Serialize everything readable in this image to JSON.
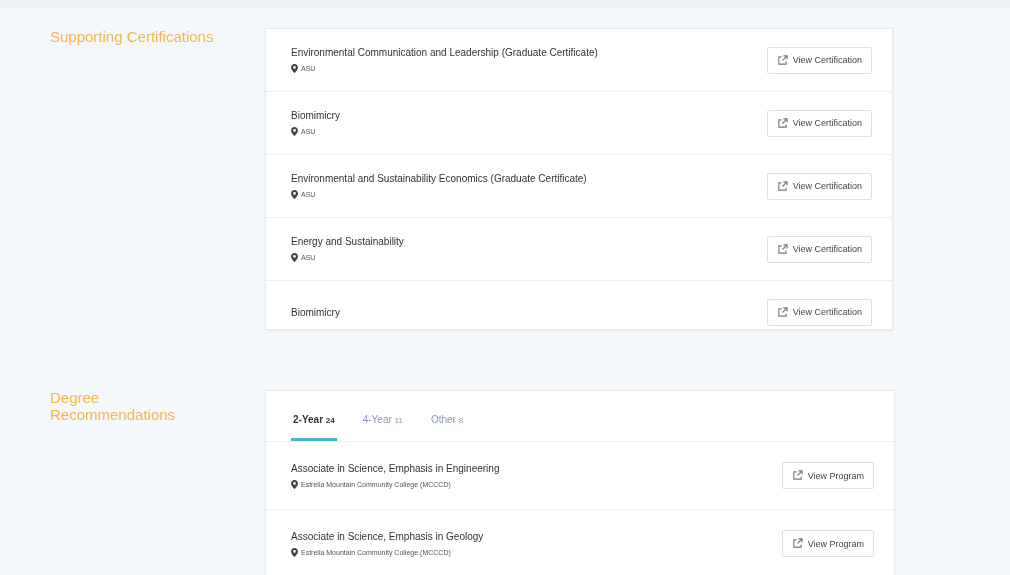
{
  "certifications": {
    "heading": "Supporting Certifications",
    "items": [
      {
        "title": "Environmental Communication and Leadership (Graduate Certificate)",
        "location": "ASU",
        "button": "View Certification"
      },
      {
        "title": "Biomimicry",
        "location": "ASU",
        "button": "View Certification"
      },
      {
        "title": "Environmental and Sustainability Economics (Graduate Certificate)",
        "location": "ASU",
        "button": "View Certification"
      },
      {
        "title": "Energy and Sustainability",
        "location": "ASU",
        "button": "View Certification"
      },
      {
        "title": "Biomimicry",
        "button": "View Certification"
      }
    ]
  },
  "degrees": {
    "heading": "Degree Recommendations",
    "tabs": [
      {
        "label": "2-Year",
        "count": "24",
        "selected": true
      },
      {
        "label": "4-Year",
        "count": "11",
        "selected": false
      },
      {
        "label": "Other",
        "count": "8",
        "selected": false
      }
    ],
    "items": [
      {
        "title": "Associate in Science, Emphasis in Engineering",
        "location": "Estrella Mountain Community College (MCCCD)",
        "button": "View Program"
      },
      {
        "title": "Associate in Science, Emphasis in Geology",
        "location": "Estrella Mountain Community College (MCCCD)",
        "button": "View Program"
      }
    ]
  }
}
